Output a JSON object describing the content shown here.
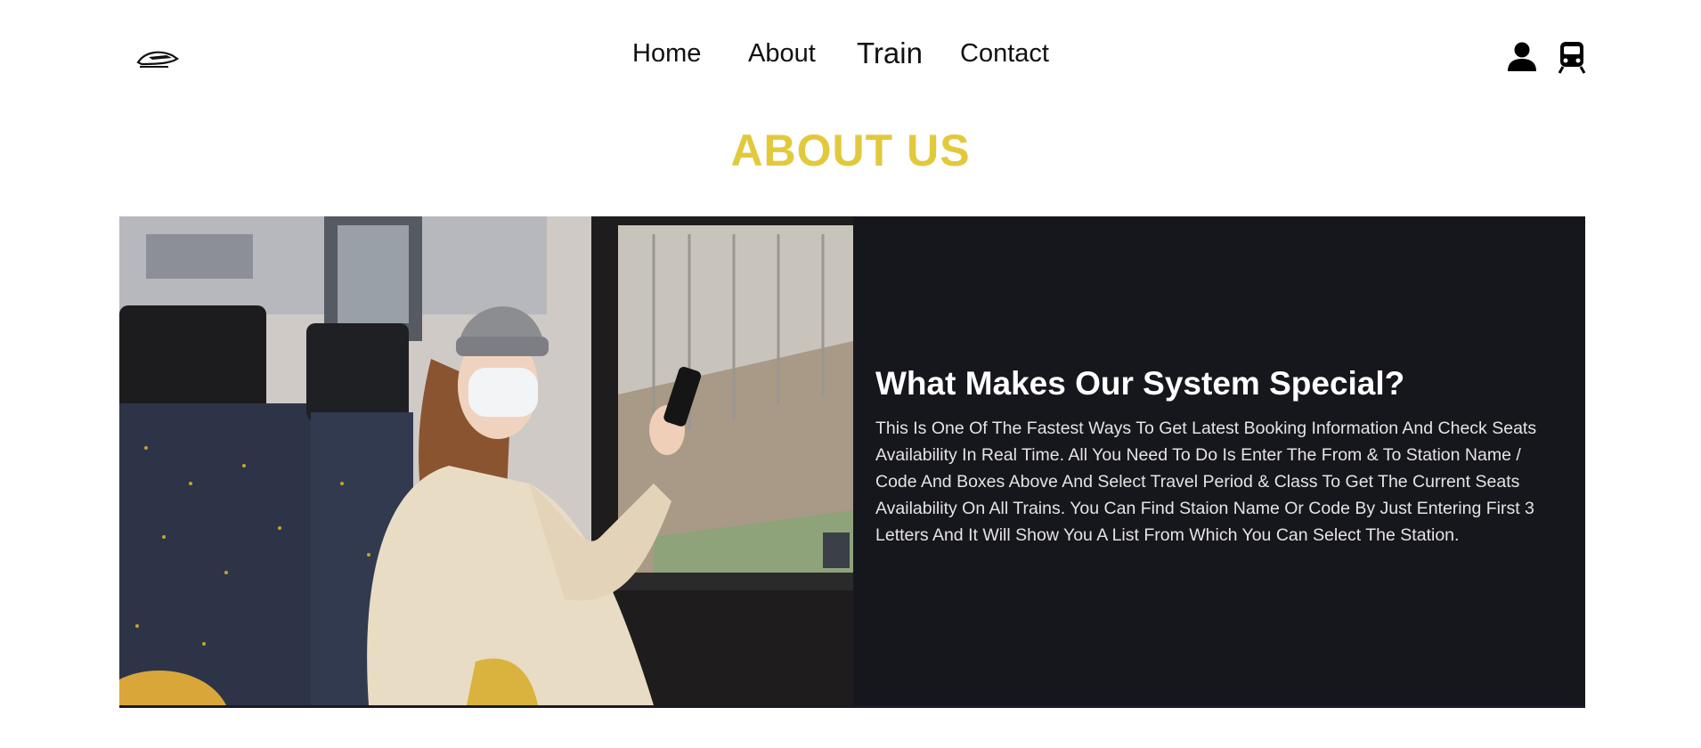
{
  "nav": {
    "links": [
      "Home",
      "About",
      "Train",
      "Contact"
    ],
    "icons": [
      "train-logo-icon",
      "user-icon",
      "train-front-icon"
    ]
  },
  "about": {
    "title": "ABOUT US",
    "heading": "What Makes Our System Special?",
    "body": "This Is One Of The Fastest Ways To Get Latest Booking Information And Check Seats Availability In Real Time. All You Need To Do Is Enter The From & To Station Name / Code And Boxes Above And Select Travel Period & Class To Get The Current Seats Availability On All Trains. You Can Find Staion Name Or Code By Just Entering First 3 Letters And It Will Show You A List From Which You Can Select The Station."
  },
  "colors": {
    "accent": "#e2c93c",
    "panel": "#16161d"
  }
}
